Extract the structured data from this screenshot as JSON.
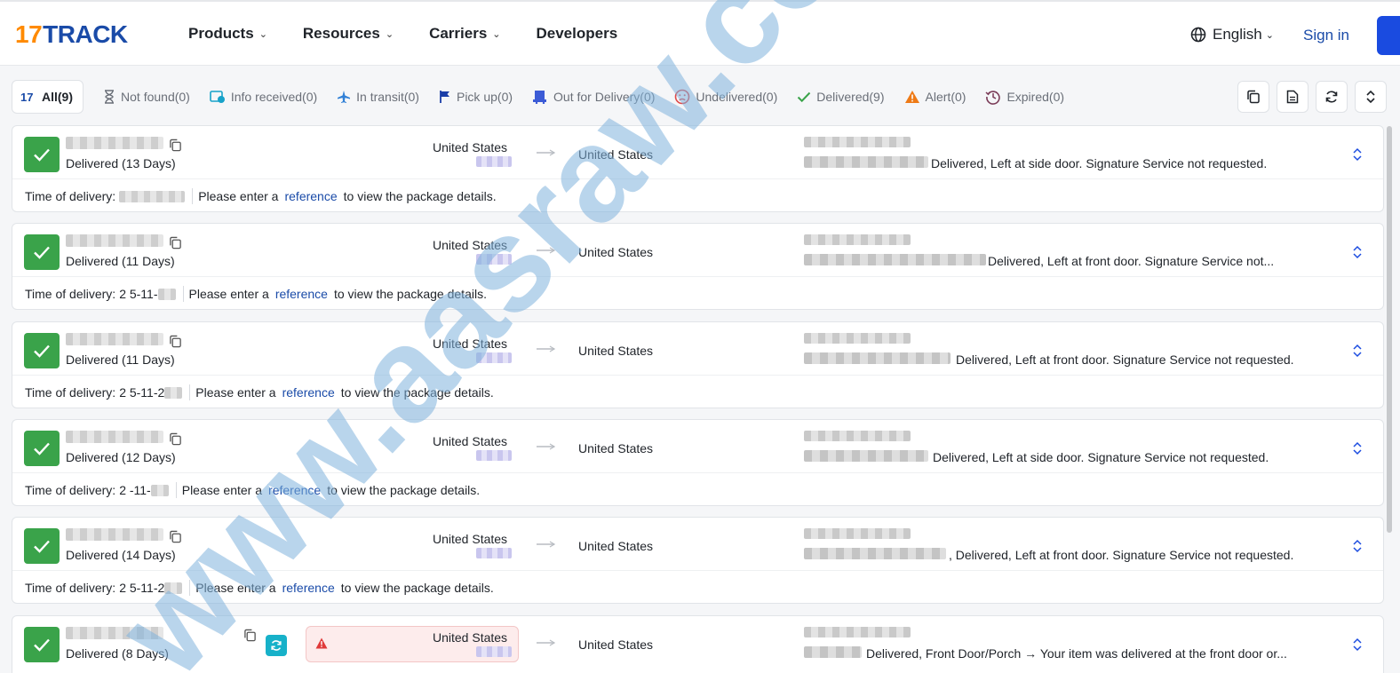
{
  "header": {
    "logo_number": "17",
    "logo_text": "TRACK",
    "nav": [
      "Products",
      "Resources",
      "Carriers",
      "Developers"
    ],
    "language": "English",
    "signin": "Sign in"
  },
  "filters": [
    {
      "label": "All",
      "count": "(9)",
      "icon": "17track-logo-icon",
      "active": true
    },
    {
      "label": "Not found",
      "count": "(0)",
      "icon": "hourglass-icon"
    },
    {
      "label": "Info received",
      "count": "(0)",
      "icon": "info-received-icon"
    },
    {
      "label": "In transit",
      "count": "(0)",
      "icon": "airplane-icon"
    },
    {
      "label": "Pick up",
      "count": "(0)",
      "icon": "flag-icon"
    },
    {
      "label": "Out for Delivery",
      "count": "(0)",
      "icon": "delivery-truck-icon"
    },
    {
      "label": "Undelivered",
      "count": "(0)",
      "icon": "sad-face-icon"
    },
    {
      "label": "Delivered",
      "count": "(9)",
      "icon": "checkmark-icon"
    },
    {
      "label": "Alert",
      "count": "(0)",
      "icon": "alert-triangle-icon"
    },
    {
      "label": "Expired",
      "count": "(0)",
      "icon": "history-clock-icon"
    }
  ],
  "toolbar": [
    "copy-all-icon",
    "export-document-icon",
    "refresh-icon",
    "expand-collapse-icon"
  ],
  "packages": [
    {
      "status": "Delivered (13 Days)",
      "origin": "United States",
      "destination": "United States",
      "event": "Delivered, Left at side door. Signature Service not requested.",
      "delivery_label": "Time of delivery:",
      "delivery_time": "",
      "prompt_before": "Please enter a",
      "prompt_link": "reference",
      "prompt_after": "to view the package details."
    },
    {
      "status": "Delivered (11 Days)",
      "origin": "United States",
      "destination": "United States",
      "event": "Delivered, Left at front door. Signature Service not...",
      "delivery_label": "Time of delivery:",
      "delivery_time": "2  5-11-",
      "prompt_before": "Please enter a",
      "prompt_link": "reference",
      "prompt_after": "to view the package details."
    },
    {
      "status": "Delivered (11 Days)",
      "origin": "United States",
      "destination": "United States",
      "event": "Delivered, Left at front door. Signature Service not requested.",
      "delivery_label": "Time of delivery:",
      "delivery_time": "2  5-11-2",
      "prompt_before": "Please enter a",
      "prompt_link": "reference",
      "prompt_after": "to view the package details."
    },
    {
      "status": "Delivered (12 Days)",
      "origin": "United States",
      "destination": "United States",
      "event": "Delivered, Left at side door. Signature Service not requested.",
      "delivery_label": "Time of delivery:",
      "delivery_time": "2   -11-",
      "prompt_before": "Please enter a",
      "prompt_link": "reference",
      "prompt_after": "to view the package details."
    },
    {
      "status": "Delivered (14 Days)",
      "origin": "United States",
      "destination": "United States",
      "event": ", Delivered, Left at front door. Signature Service not requested.",
      "delivery_label": "Time of delivery:",
      "delivery_time": "2  5-11-2",
      "prompt_before": "Please enter a",
      "prompt_link": "reference",
      "prompt_after": "to view the package details."
    },
    {
      "status": "Delivered (8 Days)",
      "origin": "United States",
      "destination": "United States",
      "event": "Delivered, Front Door/Porch → Your item was delivered at the front door or..."
    }
  ],
  "watermark": "www.aasraw.co",
  "colors": {
    "brand_orange": "#ff8a00",
    "brand_blue": "#1a4ba8",
    "delivered_green": "#3aa34a",
    "sync_cyan": "#17b1c9",
    "alert_red": "#e03a3a"
  }
}
